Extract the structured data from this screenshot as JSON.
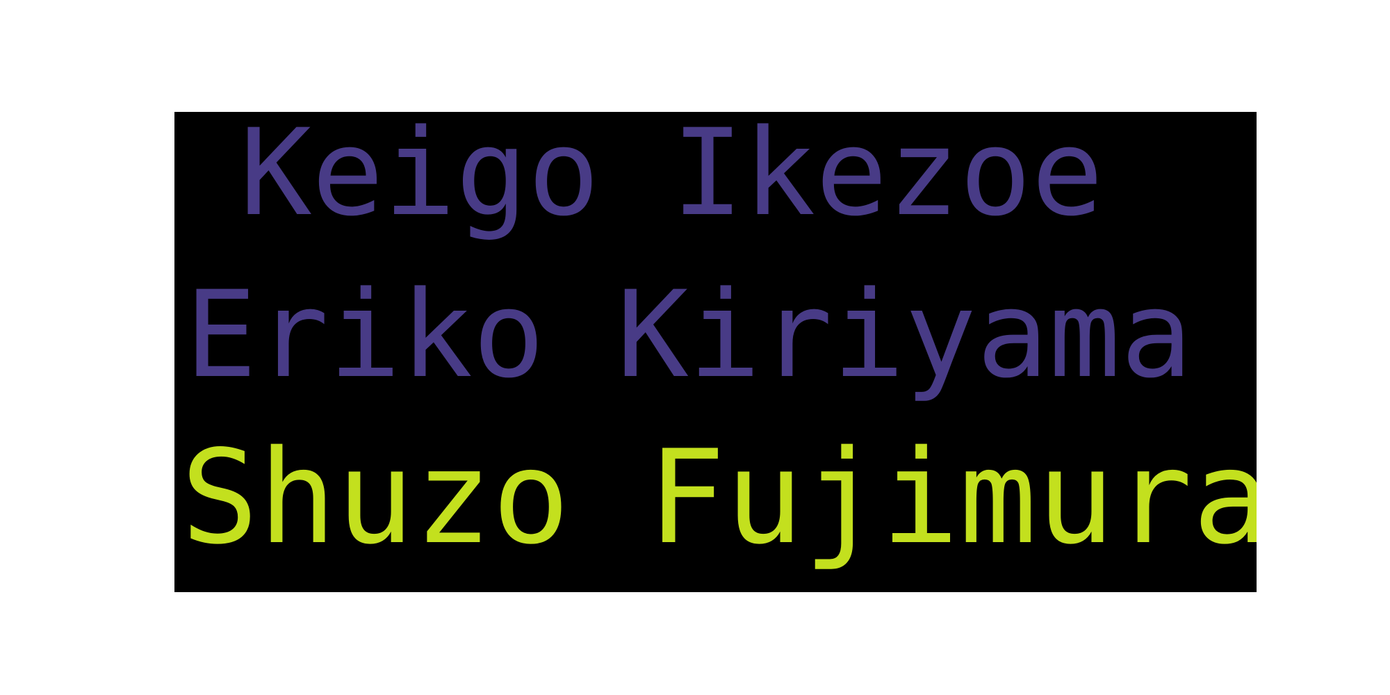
{
  "words": [
    {
      "text": "Keigo Ikezoe",
      "color": "#483b86"
    },
    {
      "text": "Eriko Kiriyama",
      "color": "#483b86"
    },
    {
      "text": "Shuzo Fujimura",
      "color": "#c3e01e"
    }
  ],
  "background_color": "#000000"
}
